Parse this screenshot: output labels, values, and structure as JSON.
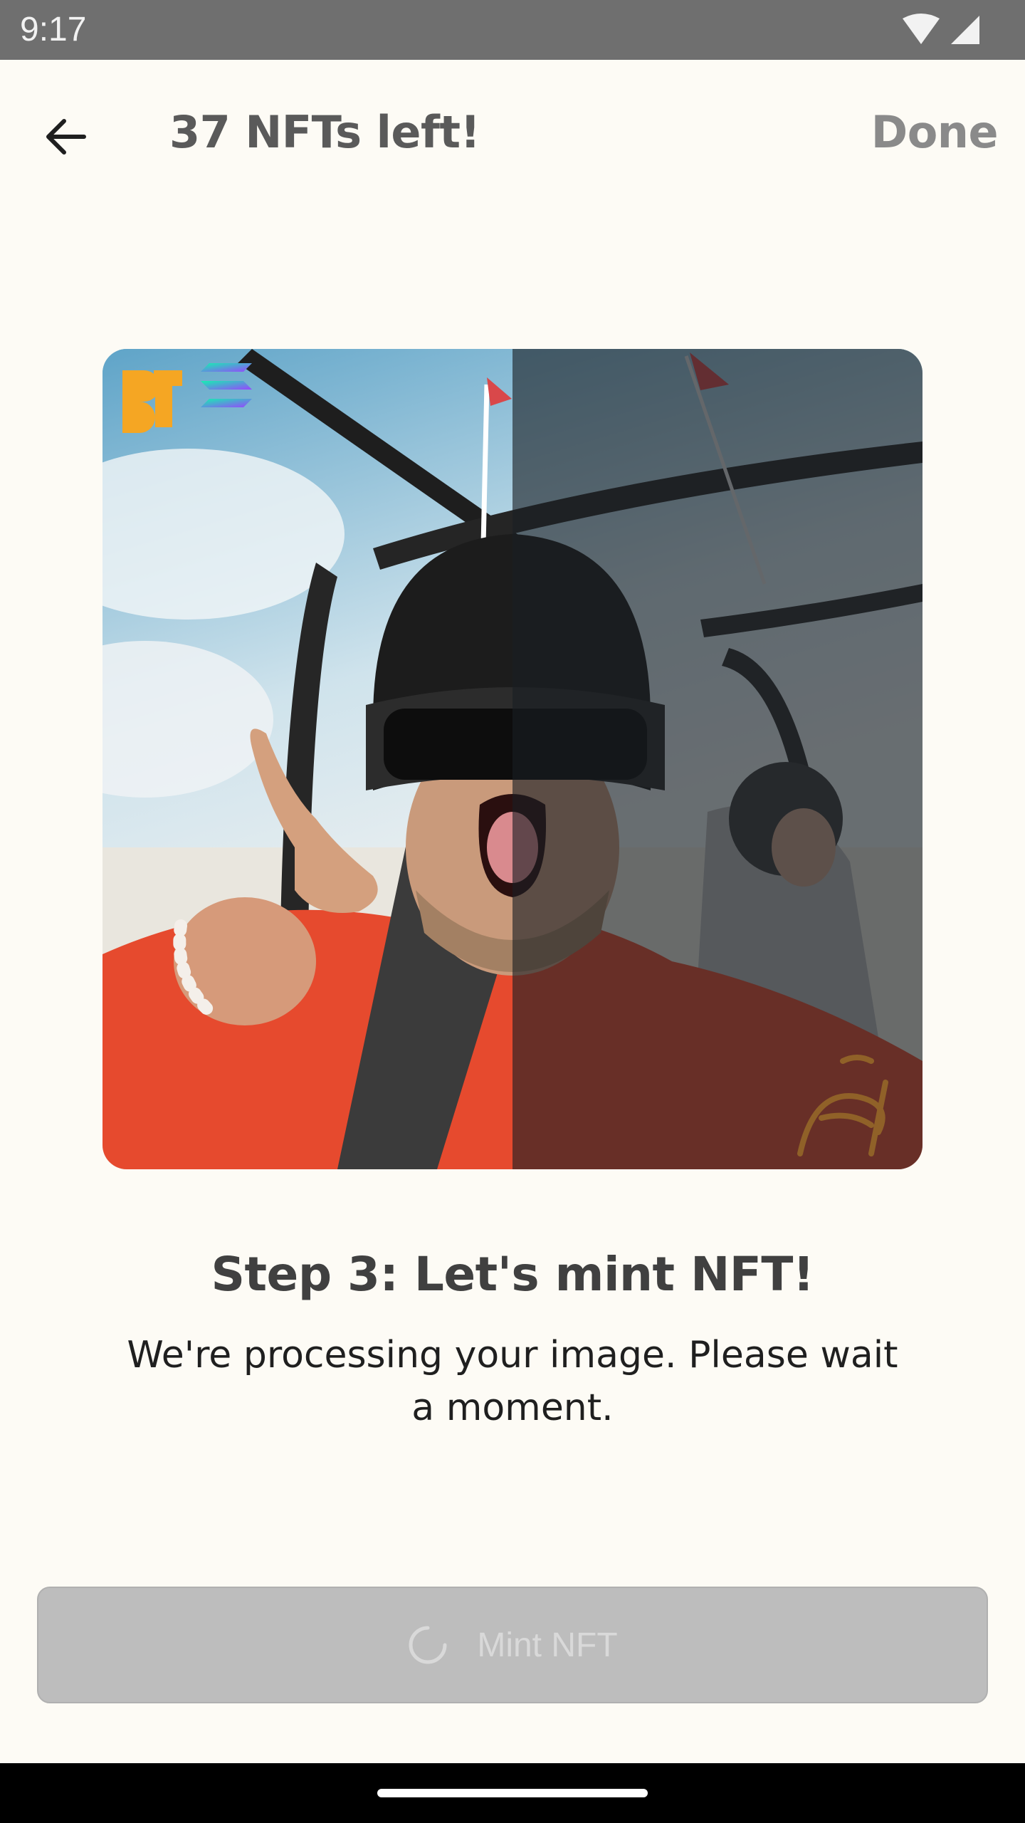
{
  "status_bar": {
    "time": "9:17",
    "icons": [
      "wifi-icon",
      "cellular-signal-icon"
    ]
  },
  "app_bar": {
    "back_icon": "arrow-left-icon",
    "title": "37 NFTs left!",
    "done_label": "Done"
  },
  "nft_preview": {
    "badges": [
      "brand-logo-icon",
      "solana-logo-icon"
    ],
    "overlay_side": "right-half-darkened",
    "watermark": "Gemini Rally"
  },
  "step": {
    "title": "Step 3: Let's mint NFT!",
    "description": "We're processing your image. Please wait a moment."
  },
  "mint_button": {
    "label": "Mint NFT",
    "state": "disabled-loading",
    "spinner_icon": "loading-spinner-icon"
  },
  "colors": {
    "background": "#fdfbf5",
    "status_bar": "#6f6f6f",
    "button_disabled": "#bdbdbd",
    "brand_orange": "#f5a623"
  }
}
